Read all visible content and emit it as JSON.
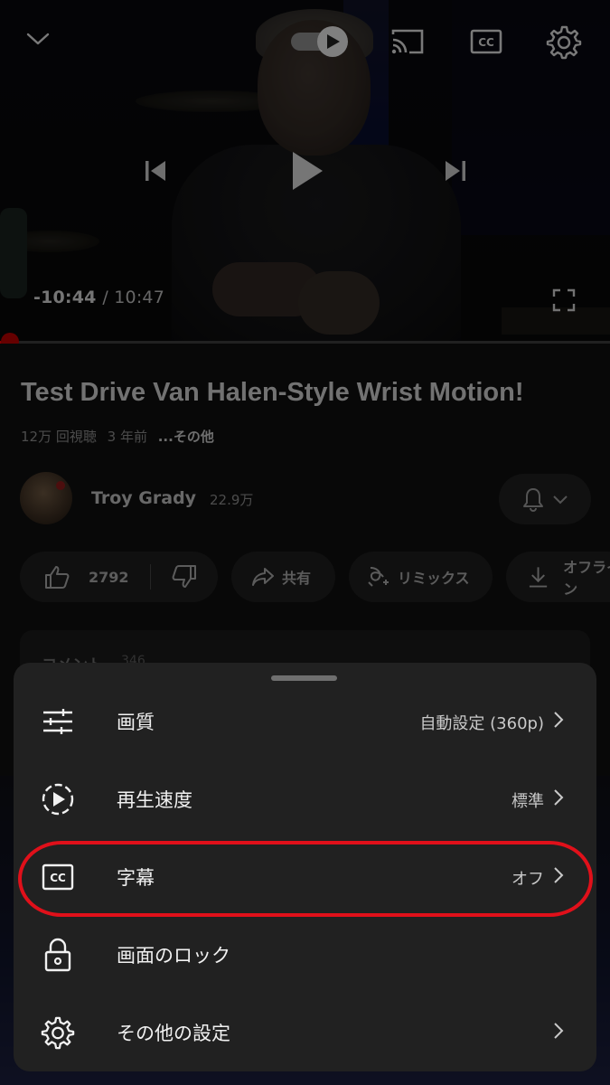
{
  "player": {
    "time_remaining": "-10:44",
    "time_total": "/ 10:47",
    "progress_fraction": 0.005,
    "icons": [
      "chevron-down-icon",
      "autoplay-toggle-icon",
      "cast-icon",
      "captions-icon",
      "settings-gear-icon",
      "previous-icon",
      "play-icon",
      "next-icon",
      "fullscreen-icon"
    ]
  },
  "video": {
    "title": "Test Drive Van Halen-Style Wrist Motion!",
    "views": "12万 回視聴",
    "age": "3 年前",
    "more": "...その他"
  },
  "channel": {
    "name": "Troy Grady",
    "subscribers": "22.9万"
  },
  "actions": {
    "like_count": "2792",
    "share": "共有",
    "remix": "リミックス",
    "offline": "オフライン"
  },
  "comments": {
    "label": "コメント",
    "count": "346"
  },
  "settings_sheet": {
    "items": [
      {
        "label": "画質",
        "value": "自動設定 (360p)"
      },
      {
        "label": "再生速度",
        "value": "標準"
      },
      {
        "label": "字幕",
        "value": "オフ"
      },
      {
        "label": "画面のロック",
        "value": ""
      },
      {
        "label": "その他の設定",
        "value": ""
      }
    ],
    "highlight_color": "#e0101a"
  }
}
